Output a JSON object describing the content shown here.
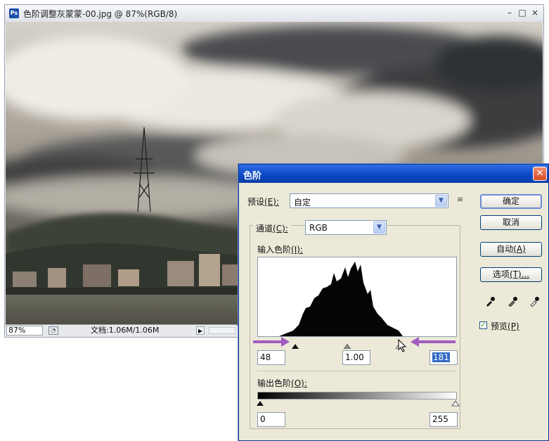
{
  "document": {
    "title": "色阶调整灰蒙蒙-00.jpg @ 87%(RGB/8)",
    "zoom": "87%",
    "doc_size": "文档:1.06M/1.06M",
    "icons": [
      "photoshop-icon",
      "minimize-icon",
      "maximize-icon",
      "close-icon"
    ]
  },
  "dialog": {
    "title": "色阶",
    "preset_label": "预设",
    "preset_key": "(E):",
    "preset_value": "自定",
    "channel_label": "通道",
    "channel_key": "(C):",
    "channel_value": "RGB",
    "input_label": "输入色阶",
    "input_key": "(I):",
    "input_black": "48",
    "input_gamma": "1.00",
    "input_white": "181",
    "output_label": "输出色阶",
    "output_key": "(O):",
    "output_black": "0",
    "output_white": "255",
    "buttons": {
      "ok": "确定",
      "cancel": "取消",
      "auto_label": "自动",
      "auto_key": "(A)",
      "options_label": "选项",
      "options_key": "(T)..."
    },
    "preview_label": "预览",
    "preview_key": "(P)",
    "preview_checked": true
  },
  "colors": {
    "title_blue": "#0b48c8",
    "close_red": "#d94a22",
    "annotation_arrow": "#a05cc0"
  }
}
